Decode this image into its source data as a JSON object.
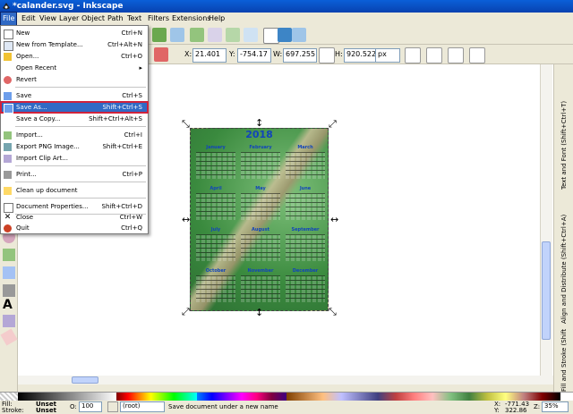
{
  "window": {
    "title": "*calander.svg - Inkscape"
  },
  "menubar": [
    "File",
    "Edit",
    "View",
    "Layer",
    "Object",
    "Path",
    "Text",
    "Filters",
    "Extensions",
    "Help"
  ],
  "file_menu": {
    "items": [
      {
        "label": "New",
        "shortcut": "Ctrl+N",
        "icon": "new-document-icon"
      },
      {
        "label": "New from Template...",
        "shortcut": "Ctrl+Alt+N",
        "icon": "template-icon"
      },
      {
        "label": "Open...",
        "shortcut": "Ctrl+O",
        "icon": "open-folder-icon"
      },
      {
        "label": "Open Recent",
        "shortcut": "",
        "icon": ""
      },
      {
        "label": "Revert",
        "shortcut": "",
        "icon": "revert-icon"
      },
      {
        "label": "Save",
        "shortcut": "Ctrl+S",
        "icon": "save-icon"
      },
      {
        "label": "Save As...",
        "shortcut": "Shift+Ctrl+S",
        "icon": "save-as-icon"
      },
      {
        "label": "Save a Copy...",
        "shortcut": "Shift+Ctrl+Alt+S",
        "icon": ""
      },
      {
        "label": "Import...",
        "shortcut": "Ctrl+I",
        "icon": "import-icon"
      },
      {
        "label": "Export PNG Image...",
        "shortcut": "Shift+Ctrl+E",
        "icon": "export-png-icon"
      },
      {
        "label": "Import Clip Art...",
        "shortcut": "",
        "icon": "clip-art-icon"
      },
      {
        "label": "Print...",
        "shortcut": "Ctrl+P",
        "icon": "print-icon"
      },
      {
        "label": "Clean up document",
        "shortcut": "",
        "icon": "clean-up-icon"
      },
      {
        "label": "Document Properties...",
        "shortcut": "Shift+Ctrl+D",
        "icon": "document-properties-icon"
      },
      {
        "label": "Close",
        "shortcut": "Ctrl+W",
        "icon": "close-icon"
      },
      {
        "label": "Quit",
        "shortcut": "Ctrl+Q",
        "icon": "quit-icon"
      }
    ],
    "highlighted": "Save As..."
  },
  "controls": {
    "x_label": "X:",
    "x_value": "21.401",
    "y_label": "Y:",
    "y_value": "-754.17",
    "w_label": "W:",
    "w_value": "697.255",
    "h_label": "H:",
    "h_value": "920.522",
    "unit": "px"
  },
  "calendar": {
    "year": "2018",
    "months": [
      "January",
      "February",
      "March",
      "April",
      "May",
      "June",
      "July",
      "August",
      "September",
      "October",
      "November",
      "December"
    ]
  },
  "dock_tabs": [
    "Text and Font (Shift+Ctrl+T)",
    "Align and Distribute (Shift+Ctrl+A)",
    "Fill and Stroke (Shift+Ctrl+F)"
  ],
  "status": {
    "fill_label": "Fill:",
    "fill_value": "Unset",
    "stroke_label": "Stroke:",
    "stroke_value": "Unset",
    "opacity_label": "O:",
    "opacity_value": "100",
    "layer": "(root)",
    "message": "Save document under a new name",
    "x_label": "X:",
    "x_coord": "-771.43",
    "y_label": "Y:",
    "y_coord": "322.86",
    "zoom_label": "Z:",
    "zoom": "35%"
  },
  "colors": {
    "titlebar": "#0842b0",
    "menu_highlight": "#316ac5",
    "highlight_outline": "#d0233c",
    "calendar_text": "#1144bb"
  }
}
